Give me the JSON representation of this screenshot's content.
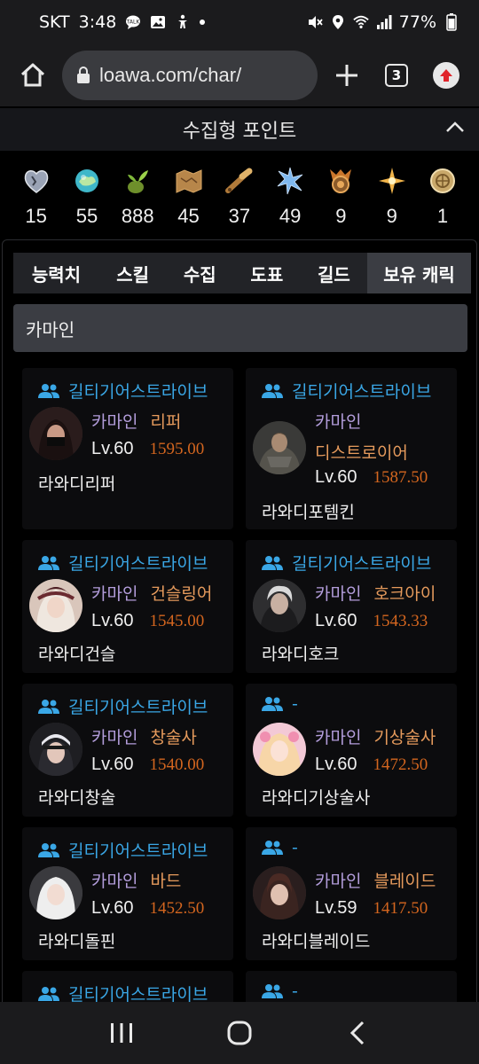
{
  "status": {
    "carrier": "SKT",
    "time": "3:48",
    "battery": "77%",
    "icons_left": [
      "talk-icon",
      "gallery-icon",
      "accessibility-icon",
      "dot-icon"
    ],
    "icons_right": [
      "mute-icon",
      "location-icon",
      "wifi-icon",
      "signal-icon",
      "battery-icon"
    ]
  },
  "browser": {
    "url": "loawa.com/char/",
    "tab_count": "3"
  },
  "collectibles": {
    "title": "수집형 포인트",
    "items": [
      {
        "icon": "heart-icon",
        "value": "15"
      },
      {
        "icon": "island-icon",
        "value": "55"
      },
      {
        "icon": "seed-icon",
        "value": "888"
      },
      {
        "icon": "map-icon",
        "value": "45"
      },
      {
        "icon": "telescope-icon",
        "value": "37"
      },
      {
        "icon": "star-leaf-icon",
        "value": "49"
      },
      {
        "icon": "medal-icon",
        "value": "9"
      },
      {
        "icon": "sparkle-icon",
        "value": "9"
      },
      {
        "icon": "coin-icon",
        "value": "1"
      }
    ]
  },
  "tabs": [
    "능력치",
    "스킬",
    "수집",
    "도표",
    "길드",
    "보유 캐릭"
  ],
  "server_filter": "카마인",
  "characters": [
    {
      "guild": "길티기어스트라이브",
      "server": "카마인",
      "class": "리퍼",
      "level": "Lv.60",
      "ilvl": "1595.00",
      "name": "라와디리퍼",
      "class_wrap": false
    },
    {
      "guild": "길티기어스트라이브",
      "server": "카마인",
      "class": "디스트로이어",
      "level": "Lv.60",
      "ilvl": "1587.50",
      "name": "라와디포템킨",
      "class_wrap": true
    },
    {
      "guild": "길티기어스트라이브",
      "server": "카마인",
      "class": "건슬링어",
      "level": "Lv.60",
      "ilvl": "1545.00",
      "name": "라와디건슬",
      "class_wrap": false
    },
    {
      "guild": "길티기어스트라이브",
      "server": "카마인",
      "class": "호크아이",
      "level": "Lv.60",
      "ilvl": "1543.33",
      "name": "라와디호크",
      "class_wrap": false
    },
    {
      "guild": "길티기어스트라이브",
      "server": "카마인",
      "class": "창술사",
      "level": "Lv.60",
      "ilvl": "1540.00",
      "name": "라와디창술",
      "class_wrap": false
    },
    {
      "guild": "-",
      "server": "카마인",
      "class": "기상술사",
      "level": "Lv.60",
      "ilvl": "1472.50",
      "name": "라와디기상술사",
      "class_wrap": false
    },
    {
      "guild": "길티기어스트라이브",
      "server": "카마인",
      "class": "바드",
      "level": "Lv.60",
      "ilvl": "1452.50",
      "name": "라와디돌핀",
      "class_wrap": false
    },
    {
      "guild": "-",
      "server": "카마인",
      "class": "블레이드",
      "level": "Lv.59",
      "ilvl": "1417.50",
      "name": "라와디블레이드",
      "class_wrap": false
    },
    {
      "guild": "길티기어스트라이브"
    },
    {
      "guild": "-"
    }
  ],
  "colors": {
    "guild": "#3aa7e6",
    "server": "#b39ddb",
    "class": "#e59a5c",
    "ilvl": "#d4661f",
    "upload_button": "#e0242b"
  }
}
